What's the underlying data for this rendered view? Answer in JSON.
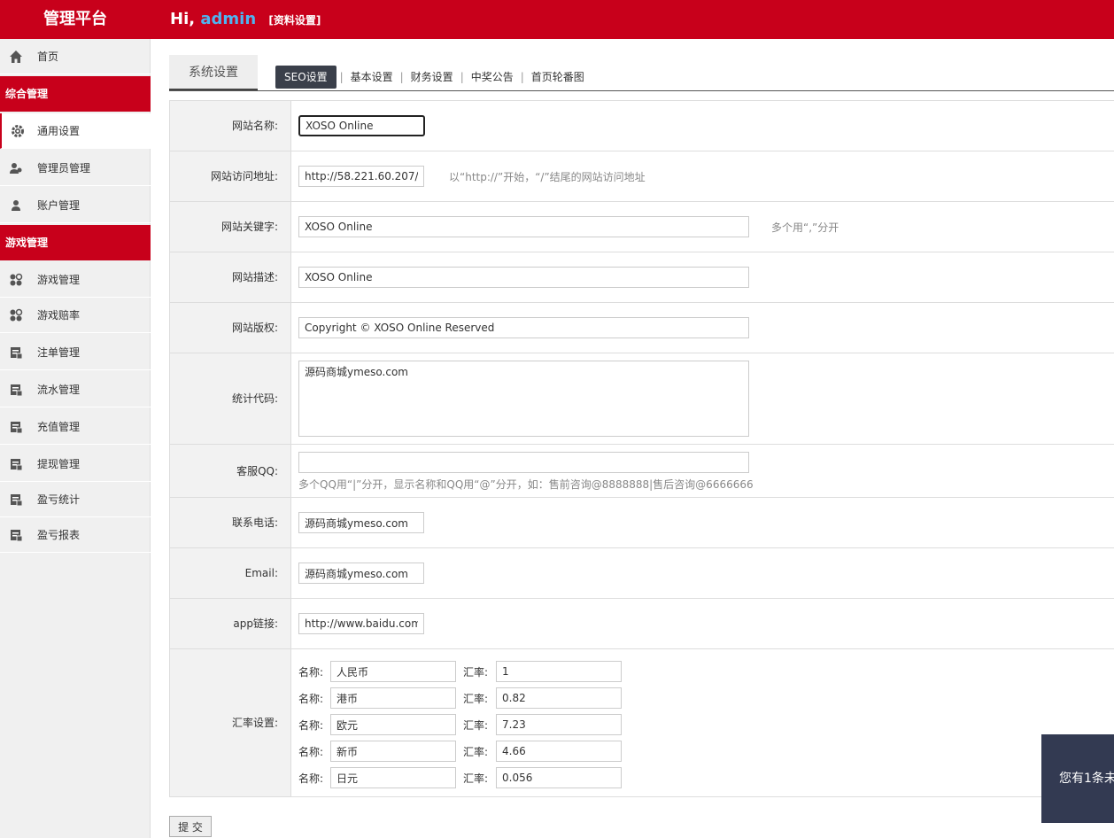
{
  "header": {
    "brand": "管理平台",
    "hi": "Hi,",
    "username": "admin",
    "profile_link": "[资料设置]"
  },
  "sidebar": {
    "items": [
      {
        "label": "首页",
        "icon": "home-icon"
      },
      {
        "group": "综合管理"
      },
      {
        "label": "通用设置",
        "icon": "gear-icon",
        "active": true
      },
      {
        "label": "管理员管理",
        "icon": "user-group-icon"
      },
      {
        "label": "账户管理",
        "icon": "user-icon"
      },
      {
        "group": "游戏管理"
      },
      {
        "label": "游戏管理",
        "icon": "grid-icon"
      },
      {
        "label": "游戏赔率",
        "icon": "grid-icon"
      },
      {
        "label": "注单管理",
        "icon": "doc-icon"
      },
      {
        "label": "流水管理",
        "icon": "doc-icon"
      },
      {
        "label": "充值管理",
        "icon": "doc-icon"
      },
      {
        "label": "提现管理",
        "icon": "doc-icon"
      },
      {
        "label": "盈亏统计",
        "icon": "doc-icon"
      },
      {
        "label": "盈亏报表",
        "icon": "doc-icon"
      }
    ]
  },
  "tabs": {
    "main": "系统设置",
    "items": [
      "SEO设置",
      "基本设置",
      "财务设置",
      "中奖公告",
      "首页轮番图"
    ],
    "active": 0
  },
  "form": {
    "site_name": {
      "label": "网站名称:",
      "value": "XOSO Online"
    },
    "site_url": {
      "label": "网站访问地址:",
      "value": "http://58.221.60.207/",
      "hint": "以“http://”开始，“/”结尾的网站访问地址"
    },
    "keywords": {
      "label": "网站关键字:",
      "value": "XOSO Online",
      "hint": "多个用“,”分开"
    },
    "description": {
      "label": "网站描述:",
      "value": "XOSO Online"
    },
    "copyright": {
      "label": "网站版权:",
      "value": "Copyright © XOSO Online Reserved"
    },
    "stats_code": {
      "label": "统计代码:",
      "value": "源码商城ymeso.com"
    },
    "service_qq": {
      "label": "客服QQ:",
      "value": "",
      "hint": "多个QQ用“|”分开，显示名称和QQ用“@”分开，如：售前咨询@8888888|售后咨询@6666666"
    },
    "phone": {
      "label": "联系电话:",
      "value": "源码商城ymeso.com"
    },
    "email": {
      "label": "Email:",
      "value": "源码商城ymeso.com"
    },
    "app_link": {
      "label": "app链接:",
      "value": "http://www.baidu.com"
    },
    "rates": {
      "label": "汇率设置:",
      "name_label": "名称:",
      "rate_label": "汇率:",
      "rows": [
        {
          "name": "人民币",
          "rate": "1"
        },
        {
          "name": "港币",
          "rate": "0.82"
        },
        {
          "name": "欧元",
          "rate": "7.23"
        },
        {
          "name": "新币",
          "rate": "4.66"
        },
        {
          "name": "日元",
          "rate": "0.056"
        }
      ]
    },
    "submit": "提 交"
  },
  "notice": "您有1条未"
}
